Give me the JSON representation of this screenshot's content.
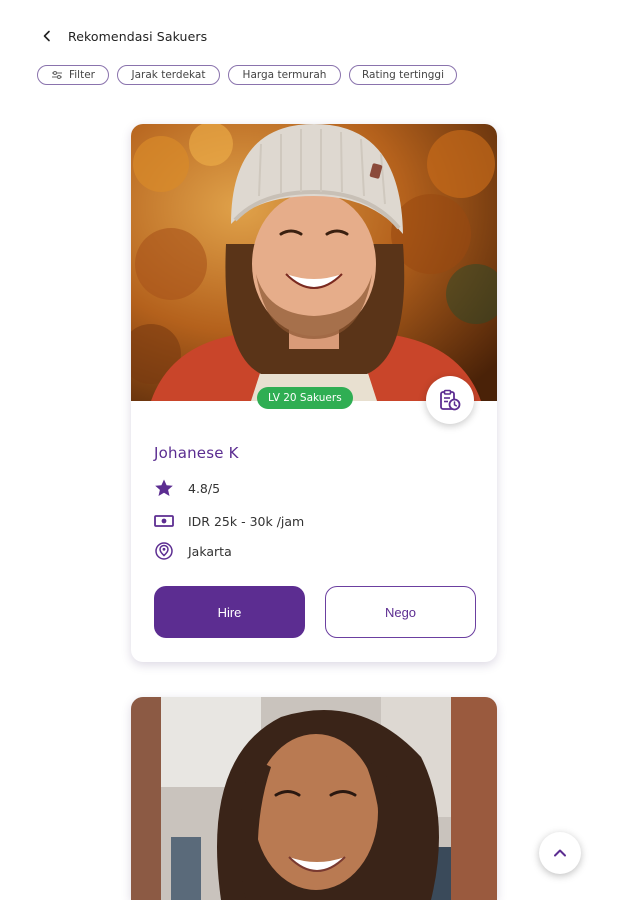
{
  "header": {
    "title": "Rekomendasi Sakuers",
    "back_icon": "chevron-left-icon"
  },
  "filters": [
    {
      "label": "Filter",
      "icon": "sliders-icon"
    },
    {
      "label": "Jarak terdekat"
    },
    {
      "label": "Harga termurah"
    },
    {
      "label": "Rating tertinggi"
    }
  ],
  "cards": [
    {
      "level_badge": "LV 20 Sakuers",
      "name": "Johanese K",
      "rating": "4.8/5",
      "price": "IDR 25k - 30k /jam",
      "location": "Jakarta",
      "hire_label": "Hire",
      "nego_label": "Nego",
      "photo_icon": "profile-photo",
      "schedule_icon": "clipboard-clock-icon"
    }
  ],
  "colors": {
    "accent": "#5c2d91",
    "badge": "#2fae53",
    "name": "#5b2d91"
  },
  "scroll_top_icon": "chevron-up-icon"
}
